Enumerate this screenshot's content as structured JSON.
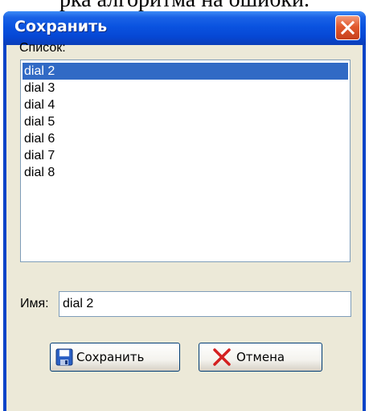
{
  "background": {
    "heading_fragment": "рка алгоритма на ошибки."
  },
  "window": {
    "title": "Сохранить",
    "close_icon": "close-icon"
  },
  "list": {
    "label": "Список:",
    "selected_index": 0,
    "items": [
      "dial 2",
      "dial 3",
      "dial 4",
      "dial 5",
      "dial 6",
      "dial 7",
      "dial 8"
    ]
  },
  "name_field": {
    "label": "Имя:",
    "value": "dial 2"
  },
  "buttons": {
    "save_label": "Сохранить",
    "save_icon": "floppy-disk-icon",
    "cancel_label": "Отмена",
    "cancel_icon": "red-x-icon"
  },
  "colors": {
    "titlebar": "#0a53e0",
    "selection": "#316ac5",
    "dialog_face": "#ece9d8",
    "close_button": "#e15a2e"
  }
}
